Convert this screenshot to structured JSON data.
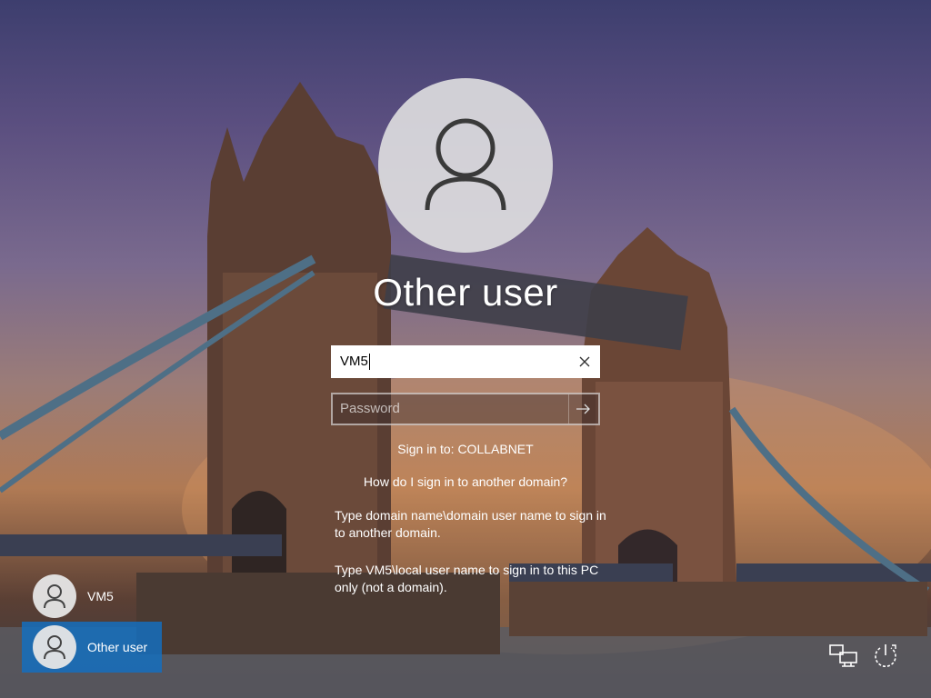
{
  "screen": {
    "title": "Other user",
    "username_value": "VM5",
    "password_placeholder": "Password",
    "sign_in_to": "Sign in to: COLLABNET",
    "help_link": "How do I sign in to another domain?",
    "help_text_1": "Type domain name\\domain user name to sign in to another domain.",
    "help_text_2": "Type VM5\\local user name to sign in to this PC only (not a domain)."
  },
  "users": [
    {
      "name": "VM5",
      "selected": false
    },
    {
      "name": "Other user",
      "selected": true
    }
  ],
  "icons": {
    "avatar": "user-silhouette-icon",
    "clear": "close-icon",
    "submit": "arrow-right-icon",
    "network": "network-icon",
    "power": "power-icon"
  },
  "colors": {
    "selected_tile": "#146ebe",
    "avatar_bg": "#e2e2e2"
  }
}
